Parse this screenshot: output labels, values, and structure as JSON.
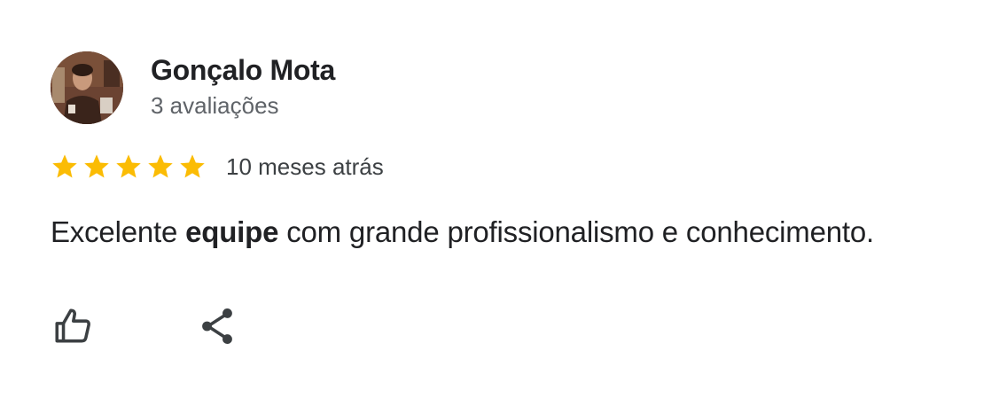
{
  "review": {
    "author": {
      "name": "Gonçalo Mota",
      "meta": "3 avaliações"
    },
    "rating": {
      "stars": 5,
      "max": 5,
      "star_color": "#fbbc04"
    },
    "date": "10 meses atrás",
    "text": {
      "before": "Excelente ",
      "emphasis": "equipe",
      "after": " com grande profissionalismo e conhecimento."
    },
    "actions": [
      {
        "icon": "thumbs-up-icon"
      },
      {
        "icon": "share-icon"
      }
    ],
    "icon_color": "#3c4043"
  }
}
